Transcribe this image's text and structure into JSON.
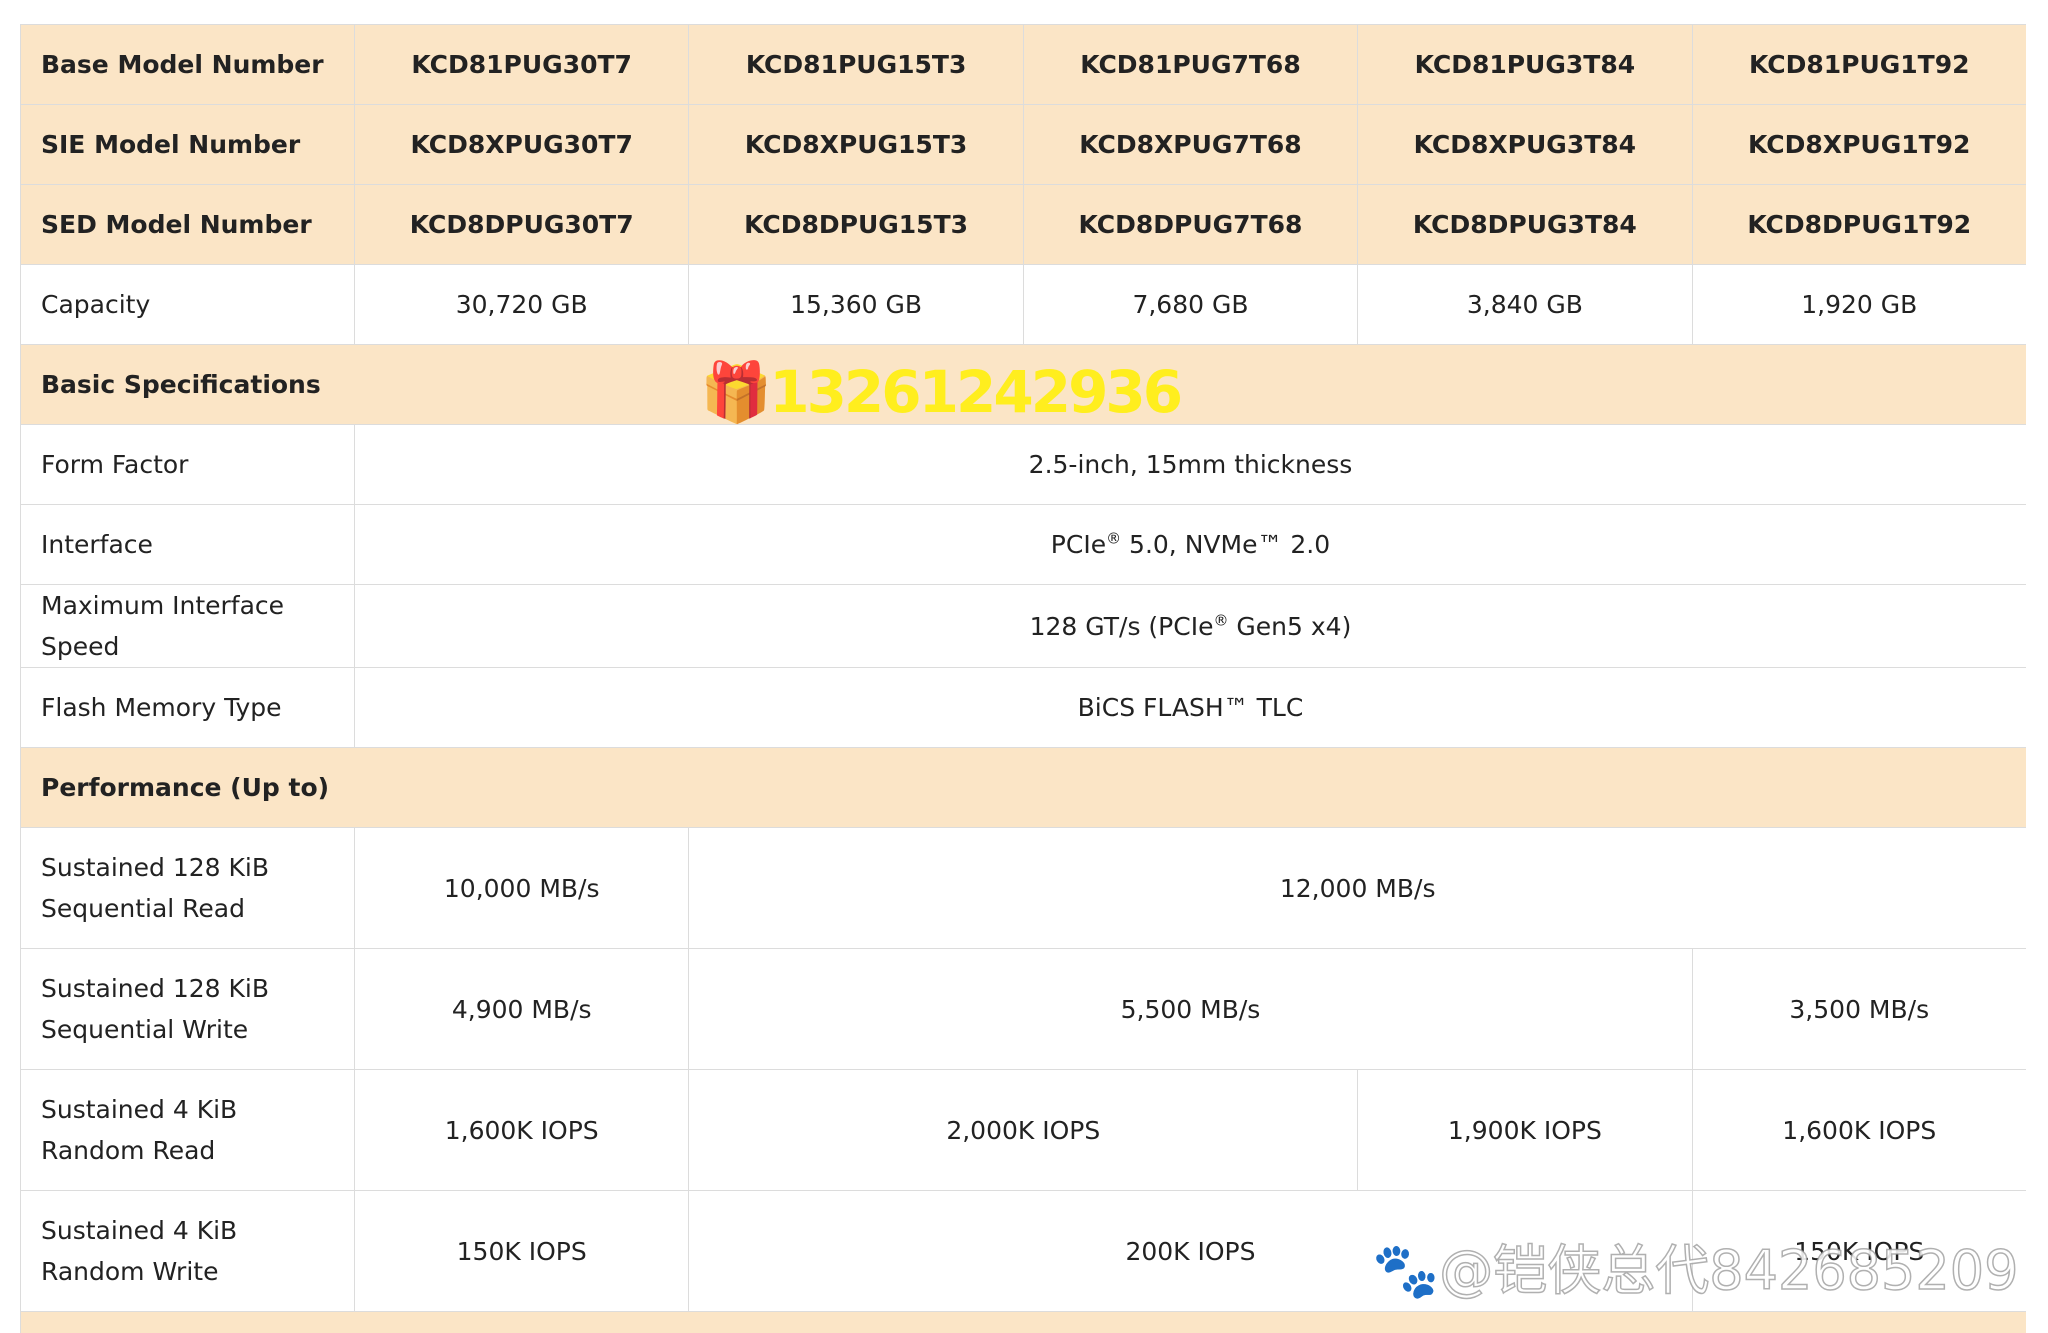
{
  "colors": {
    "section_background": "#fbe5c6",
    "border": "#dcdcdc",
    "text": "#222222"
  },
  "model_rows": [
    {
      "label": "Base Model Number",
      "values": [
        "KCD81PUG30T7",
        "KCD81PUG15T3",
        "KCD81PUG7T68",
        "KCD81PUG3T84",
        "KCD81PUG1T92"
      ]
    },
    {
      "label": "SIE Model Number",
      "values": [
        "KCD8XPUG30T7",
        "KCD8XPUG15T3",
        "KCD8XPUG7T68",
        "KCD8XPUG3T84",
        "KCD8XPUG1T92"
      ]
    },
    {
      "label": "SED Model Number",
      "values": [
        "KCD8DPUG30T7",
        "KCD8DPUG15T3",
        "KCD8DPUG7T68",
        "KCD8DPUG3T84",
        "KCD8DPUG1T92"
      ]
    }
  ],
  "capacity": {
    "label": "Capacity",
    "values": [
      "30,720 GB",
      "15,360 GB",
      "7,680 GB",
      "3,840 GB",
      "1,920 GB"
    ]
  },
  "basic_specs": {
    "title": "Basic Specifications",
    "form_factor": {
      "label": "Form Factor",
      "value": "2.5-inch, 15mm thickness"
    },
    "interface": {
      "label": "Interface",
      "value_a": "PCIe",
      "value_b": " 5.0, NVMe™ 2.0"
    },
    "max_speed": {
      "label": "Maximum Interface Speed",
      "value_a": "128 GT/s (PCIe",
      "value_b": " Gen5 x4)"
    },
    "flash": {
      "label": "Flash Memory Type",
      "value": "BiCS FLASH™ TLC"
    }
  },
  "registered_mark": "®",
  "performance": {
    "title": "Performance (Up to)",
    "seq_read": {
      "label": "Sustained 128 KiB Sequential Read",
      "v1": "10,000 MB/s",
      "v2": "12,000 MB/s"
    },
    "seq_write": {
      "label": "Sustained 128 KiB Sequential Write",
      "v1": "4,900 MB/s",
      "v2": "5,500 MB/s",
      "v3": "3,500 MB/s"
    },
    "rand_read": {
      "label": "Sustained 4 KiB Random Read",
      "v1": "1,600K IOPS",
      "v2": "2,000K IOPS",
      "v3": "1,900K IOPS",
      "v4": "1,600K IOPS"
    },
    "rand_write": {
      "label": "Sustained 4 KiB Random Write",
      "v1": "150K IOPS",
      "v2": "200K IOPS",
      "v3": "150K IOPS"
    }
  },
  "watermarks": {
    "phone": "13261242936",
    "baidu": "@铠侠总代842685209"
  }
}
